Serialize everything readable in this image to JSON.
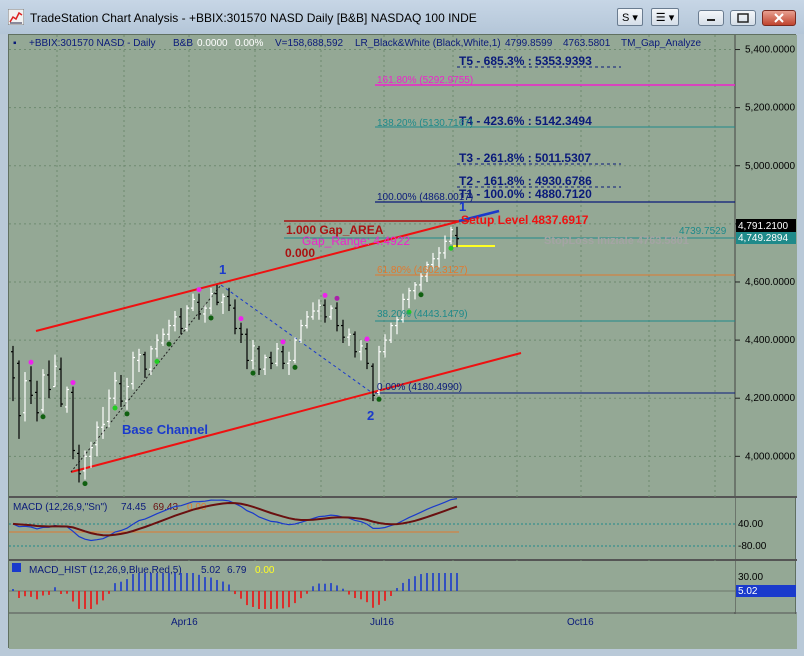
{
  "window": {
    "title": "TradeStation Chart Analysis - +BBIX:301570 NASD Daily [B&B] NASDAQ 100 INDE",
    "s_button": "S",
    "list_button": "☰"
  },
  "header": {
    "symbol": "+BBIX:301570 NASD - Daily",
    "bb": "B&B",
    "chg": "0.0000",
    "pct": "0.00%",
    "volume": "V=158,688,592",
    "study": "LR_Black&White (Black,White,1)",
    "v1": "4799.8599",
    "v2": "4763.5801",
    "study2": "TM_Gap_Analyze"
  },
  "colors": {
    "background": "#94a895",
    "red": "#ee1111",
    "navy": "#0a1a7a",
    "magenta": "#ee22cc",
    "teal": "#1f8a8a",
    "orange": "#e07a30"
  },
  "labels": {
    "t5": "T5 - 685.3% : 5353.9393",
    "fib1618": "161.80% (5292.9755)",
    "t4": "T4 - 423.6% : 5142.3494",
    "fib1382": "138.20% (5130.7167)",
    "t3": "T3 - 261.8% : 5011.5307",
    "t2": "T2 - 161.8% : 4930.6786",
    "t1": "T1 - 100.0% : 4880.7120",
    "fib100": "100.00% (4868.0017)",
    "setup": "Setup Level 4837.6917",
    "gap_area": "1.000 Gap_AREA",
    "gap_range": "Gap_Range: 4.4922",
    "zero": "0.000",
    "stoploss": "StopLoss Iniziale 4763.5801",
    "val4739": "4739.7529",
    "fib618": "61.80% (4602.3127)",
    "fib382": "38.20% (4443.1479)",
    "fib0": "0.00% (4180.4990)",
    "base_channel": "Base Channel",
    "wave1": "1",
    "wave2": "2",
    "wave3": "1"
  },
  "price_axis": {
    "ticks": [
      "5,400.0000",
      "5,200.0000",
      "5,000.0000",
      "4,800.0000",
      "4,600.0000",
      "4,400.0000",
      "4,200.0000",
      "4,000.0000"
    ],
    "last": "4,791.2100",
    "last2": "4,749.2894"
  },
  "macd": {
    "label": "MACD (12,26,9,\"Sn\")",
    "v1": "74.45",
    "v2": "69.43",
    "v3": "0.00",
    "ticks": [
      "40.00",
      "-80.00"
    ]
  },
  "macd_hist": {
    "label": "MACD_HIST (12,26,9,Blue,Red,5)",
    "v1": "5.02",
    "v2": "6.79",
    "v3": "0.00",
    "ticks": [
      "30.00"
    ],
    "last": "5.02"
  },
  "time_axis": {
    "labels": [
      "Apr16",
      "Jul16",
      "Oct16"
    ]
  },
  "chart_data": {
    "type": "ohlc",
    "price_range": [
      3860,
      5450
    ],
    "candles": [
      [
        4360,
        4380,
        4190,
        4270
      ],
      [
        4320,
        4330,
        4060,
        4140
      ],
      [
        4150,
        4290,
        4120,
        4260
      ],
      [
        4260,
        4310,
        4180,
        4210
      ],
      [
        4220,
        4260,
        4120,
        4150
      ],
      [
        4160,
        4300,
        4150,
        4280
      ],
      [
        4280,
        4330,
        4200,
        4230
      ],
      [
        4240,
        4350,
        4240,
        4310
      ],
      [
        4300,
        4340,
        4170,
        4180
      ],
      [
        4170,
        4240,
        4150,
        4230
      ],
      [
        4220,
        4240,
        3990,
        4020
      ],
      [
        4010,
        4040,
        3910,
        3940
      ],
      [
        3950,
        4020,
        3920,
        4000
      ],
      [
        4000,
        4050,
        3960,
        4030
      ],
      [
        4040,
        4120,
        4000,
        4100
      ],
      [
        4100,
        4170,
        4060,
        4110
      ],
      [
        4120,
        4230,
        4100,
        4200
      ],
      [
        4200,
        4290,
        4180,
        4260
      ],
      [
        4250,
        4280,
        4170,
        4190
      ],
      [
        4190,
        4270,
        4160,
        4240
      ],
      [
        4250,
        4360,
        4230,
        4340
      ],
      [
        4330,
        4370,
        4290,
        4350
      ],
      [
        4350,
        4360,
        4270,
        4300
      ],
      [
        4300,
        4380,
        4280,
        4370
      ],
      [
        4370,
        4420,
        4340,
        4400
      ],
      [
        4390,
        4440,
        4380,
        4420
      ],
      [
        4420,
        4470,
        4400,
        4450
      ],
      [
        4450,
        4500,
        4430,
        4480
      ],
      [
        4480,
        4510,
        4420,
        4440
      ],
      [
        4440,
        4520,
        4430,
        4510
      ],
      [
        4510,
        4560,
        4500,
        4540
      ],
      [
        4530,
        4560,
        4470,
        4490
      ],
      [
        4490,
        4520,
        4460,
        4510
      ],
      [
        4510,
        4580,
        4490,
        4560
      ],
      [
        4560,
        4590,
        4520,
        4530
      ],
      [
        4530,
        4560,
        4490,
        4550
      ],
      [
        4550,
        4580,
        4500,
        4520
      ],
      [
        4510,
        4540,
        4420,
        4440
      ],
      [
        4440,
        4460,
        4390,
        4420
      ],
      [
        4420,
        4440,
        4300,
        4330
      ],
      [
        4330,
        4400,
        4300,
        4380
      ],
      [
        4370,
        4380,
        4280,
        4300
      ],
      [
        4300,
        4350,
        4280,
        4340
      ],
      [
        4340,
        4360,
        4300,
        4320
      ],
      [
        4320,
        4390,
        4310,
        4370
      ],
      [
        4360,
        4380,
        4300,
        4320
      ],
      [
        4320,
        4360,
        4280,
        4330
      ],
      [
        4330,
        4410,
        4320,
        4400
      ],
      [
        4400,
        4470,
        4390,
        4450
      ],
      [
        4450,
        4500,
        4440,
        4480
      ],
      [
        4480,
        4530,
        4470,
        4500
      ],
      [
        4500,
        4540,
        4470,
        4520
      ],
      [
        4520,
        4540,
        4460,
        4480
      ],
      [
        4480,
        4520,
        4470,
        4510
      ],
      [
        4510,
        4530,
        4430,
        4450
      ],
      [
        4450,
        4470,
        4390,
        4410
      ],
      [
        4410,
        4440,
        4380,
        4420
      ],
      [
        4420,
        4430,
        4340,
        4360
      ],
      [
        4360,
        4400,
        4330,
        4380
      ],
      [
        4370,
        4390,
        4300,
        4320
      ],
      [
        4310,
        4320,
        4190,
        4210
      ],
      [
        4220,
        4380,
        4210,
        4360
      ],
      [
        4360,
        4420,
        4340,
        4400
      ],
      [
        4400,
        4460,
        4390,
        4450
      ],
      [
        4450,
        4480,
        4420,
        4470
      ],
      [
        4470,
        4560,
        4460,
        4540
      ],
      [
        4540,
        4580,
        4510,
        4570
      ],
      [
        4570,
        4600,
        4540,
        4590
      ],
      [
        4590,
        4630,
        4570,
        4620
      ],
      [
        4620,
        4670,
        4600,
        4660
      ],
      [
        4660,
        4700,
        4640,
        4680
      ],
      [
        4680,
        4720,
        4650,
        4700
      ],
      [
        4700,
        4760,
        4680,
        4740
      ],
      [
        4740,
        4790,
        4730,
        4780
      ],
      [
        4760,
        4790,
        4720,
        4749
      ]
    ]
  }
}
